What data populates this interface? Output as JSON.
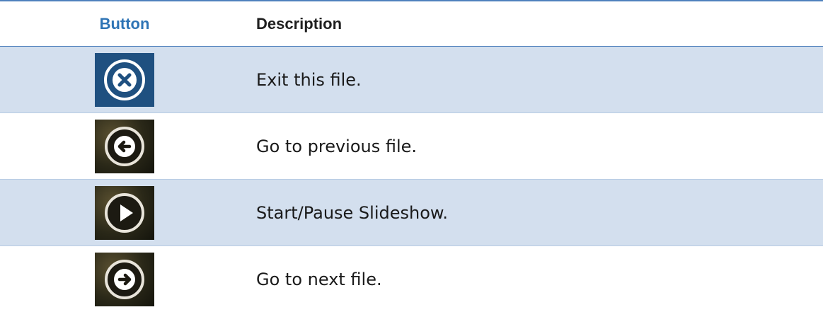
{
  "table": {
    "header": {
      "button": "Button",
      "description": "Description"
    },
    "rows": [
      {
        "icon": "close-circle-icon",
        "description": "Exit this file."
      },
      {
        "icon": "arrow-left-circle-icon",
        "description": "Go to previous file."
      },
      {
        "icon": "play-circle-icon",
        "description": "Start/Pause Slideshow."
      },
      {
        "icon": "arrow-right-circle-icon",
        "description": "Go to next file."
      }
    ]
  },
  "colors": {
    "rule": "#4f81bd",
    "header_button_text": "#2e74b5",
    "shaded_row": "#d3dfee",
    "close_tile": "#1f5080"
  }
}
